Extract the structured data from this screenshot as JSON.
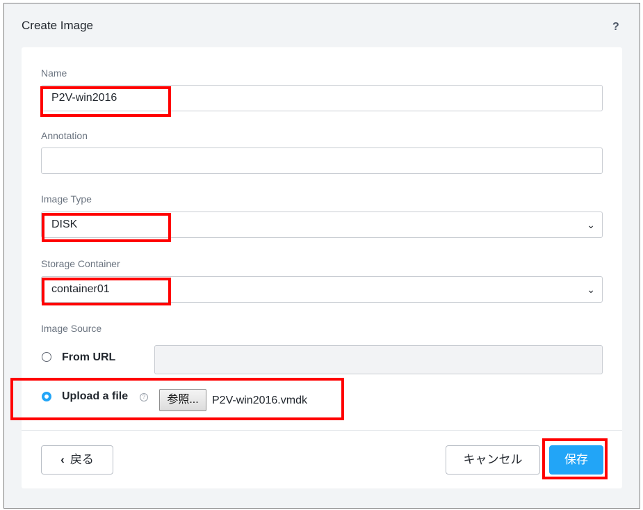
{
  "dialog": {
    "title": "Create Image",
    "help": "?"
  },
  "fields": {
    "name": {
      "label": "Name",
      "value": "P2V-win2016"
    },
    "annotation": {
      "label": "Annotation",
      "value": ""
    },
    "image_type": {
      "label": "Image Type",
      "value": "DISK"
    },
    "storage_container": {
      "label": "Storage Container",
      "value": "container01"
    }
  },
  "image_source": {
    "label": "Image Source",
    "from_url": {
      "label": "From URL",
      "checked": false,
      "url_value": ""
    },
    "upload": {
      "label": "Upload a file",
      "checked": true,
      "browse_label": "参照...",
      "file_name": "P2V-win2016.vmdk"
    }
  },
  "footer": {
    "back_label": "戻る",
    "cancel_label": "キャンセル",
    "save_label": "保存"
  },
  "colors": {
    "accent": "#22a5f7",
    "highlight": "#ff0000"
  }
}
